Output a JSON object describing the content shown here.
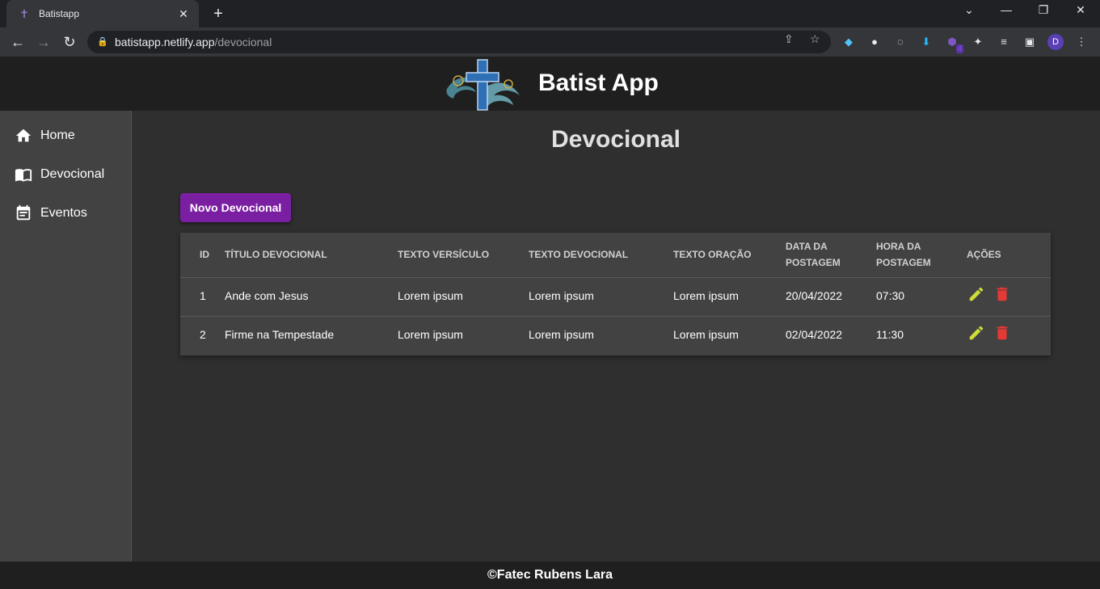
{
  "browser": {
    "tab_title": "Batistapp",
    "tab_close": "✕",
    "new_tab": "+",
    "url_host": "batistapp.netlify.app",
    "url_path": "/devocional",
    "profile_initial": "D",
    "extension_badge": "4"
  },
  "header": {
    "title": "Batist App"
  },
  "sidebar": {
    "items": [
      {
        "label": "Home",
        "icon": "home-icon"
      },
      {
        "label": "Devocional",
        "icon": "book-icon"
      },
      {
        "label": "Eventos",
        "icon": "event-note-icon"
      }
    ]
  },
  "main": {
    "title": "Devocional",
    "new_button": "Novo Devocional",
    "table": {
      "headers": [
        "ID",
        "TÍTULO DEVOCIONAL",
        "TEXTO VERSÍCULO",
        "TEXTO DEVOCIONAL",
        "TEXTO ORAÇÃO",
        "DATA DA POSTAGEM",
        "HORA DA POSTAGEM",
        "AÇÕES"
      ],
      "rows": [
        {
          "id": "1",
          "titulo": "Ande com Jesus",
          "versiculo": "Lorem ipsum",
          "devocional": "Lorem ipsum",
          "oracao": "Lorem ipsum",
          "data": "20/04/2022",
          "hora": "07:30"
        },
        {
          "id": "2",
          "titulo": "Firme na Tempestade",
          "versiculo": "Lorem ipsum",
          "devocional": "Lorem ipsum",
          "oracao": "Lorem ipsum",
          "data": "02/04/2022",
          "hora": "11:30"
        }
      ]
    }
  },
  "footer": {
    "text": "©Fatec Rubens Lara"
  },
  "colors": {
    "accent": "#7b1fa2",
    "edit": "#cddc39",
    "delete": "#e53935"
  }
}
